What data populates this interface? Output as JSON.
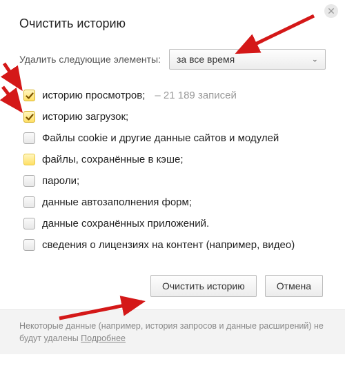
{
  "title": "Очистить историю",
  "selectRow": {
    "label": "Удалить следующие элементы:",
    "value": "за все время"
  },
  "options": [
    {
      "label": "историю просмотров;",
      "checked": true,
      "highlight": false,
      "note": "– 21 189 записей",
      "name": "opt-browsing-history"
    },
    {
      "label": "историю загрузок;",
      "checked": true,
      "highlight": false,
      "note": "",
      "name": "opt-downloads-history"
    },
    {
      "label": "Файлы cookie и другие данные сайтов и модулей",
      "checked": false,
      "highlight": false,
      "note": "",
      "name": "opt-cookies"
    },
    {
      "label": "файлы, сохранённые в кэше;",
      "checked": false,
      "highlight": true,
      "note": "",
      "name": "opt-cache"
    },
    {
      "label": "пароли;",
      "checked": false,
      "highlight": false,
      "note": "",
      "name": "opt-passwords"
    },
    {
      "label": "данные автозаполнения форм;",
      "checked": false,
      "highlight": false,
      "note": "",
      "name": "opt-autofill"
    },
    {
      "label": "данные сохранённых приложений.",
      "checked": false,
      "highlight": false,
      "note": "",
      "name": "opt-apps-data"
    },
    {
      "label": "сведения о лицензиях на контент (например, видео)",
      "checked": false,
      "highlight": false,
      "note": "",
      "name": "opt-licenses"
    }
  ],
  "actions": {
    "clear": "Очистить историю",
    "cancel": "Отмена"
  },
  "footer": {
    "text": "Некоторые данные (например, история запросов и данные расширений) не будут удалены ",
    "link": "Подробнее"
  },
  "annotations": {
    "arrowColor": "#d41818"
  }
}
